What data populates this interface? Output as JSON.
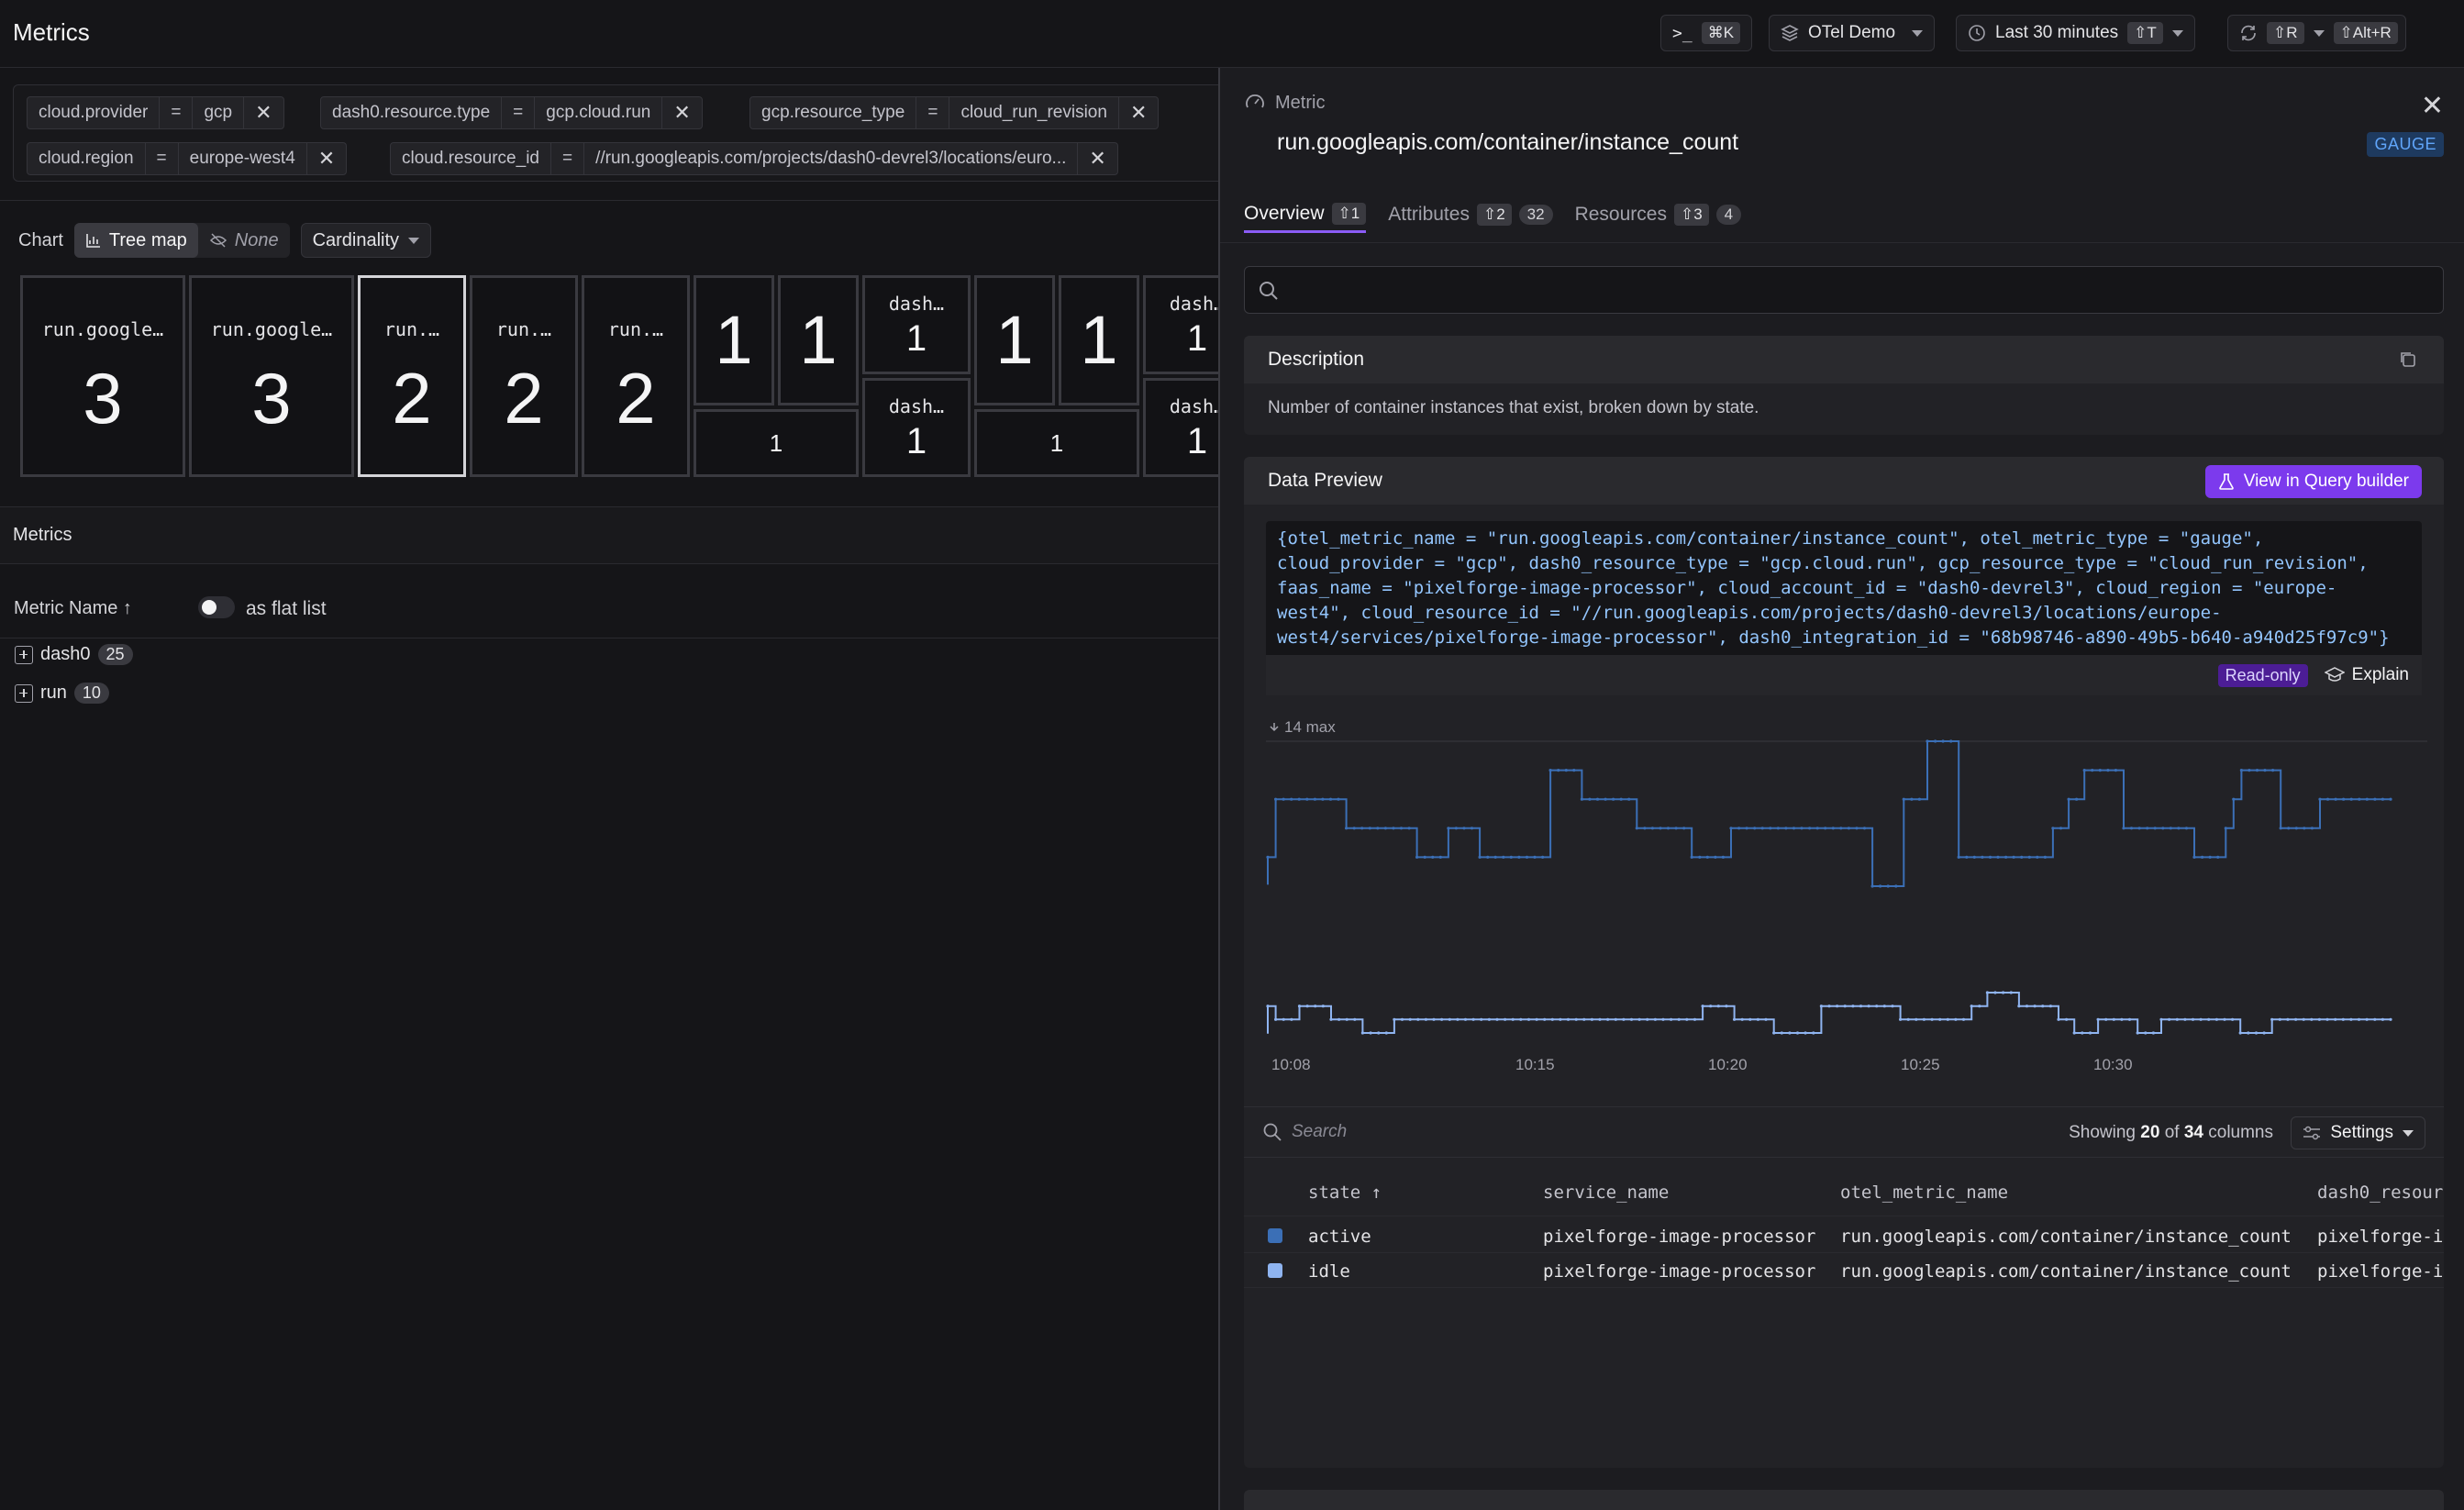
{
  "app": {
    "title": "Metrics"
  },
  "topbar": {
    "command_kbd": "⌘K",
    "dataset": "OTel Demo",
    "time_range": "Last 30 minutes",
    "time_kbd": "⇧T",
    "refresh_kbd": "⇧R",
    "alt_kbd": "⇧Alt+R"
  },
  "filters": [
    {
      "key": "cloud.provider",
      "op": "=",
      "value": "gcp"
    },
    {
      "key": "dash0.resource.type",
      "op": "=",
      "value": "gcp.cloud.run"
    },
    {
      "key": "gcp.resource_type",
      "op": "=",
      "value": "cloud_run_revision"
    },
    {
      "key": "cloud.region",
      "op": "=",
      "value": "europe-west4"
    },
    {
      "key": "cloud.resource_id",
      "op": "=",
      "value": "//run.googleapis.com/projects/dash0-devrel3/locations/euro..."
    }
  ],
  "chart_controls": {
    "label": "Chart",
    "treemap": "Tree map",
    "none": "None",
    "cardinality": "Cardinality"
  },
  "treemap": [
    {
      "label": "run.google…",
      "value": "3"
    },
    {
      "label": "run.google…",
      "value": "3"
    },
    {
      "label": "run.…",
      "value": "2"
    },
    {
      "label": "run.…",
      "value": "2"
    },
    {
      "label": "run.…",
      "value": "2"
    },
    {
      "label": "",
      "value": "1"
    },
    {
      "label": "",
      "value": "1"
    },
    {
      "label": "",
      "value": "1"
    },
    {
      "label": "dash…",
      "value": "1"
    },
    {
      "label": "dash…",
      "value": "1"
    },
    {
      "label": "",
      "value": "1"
    },
    {
      "label": "",
      "value": "1"
    },
    {
      "label": "",
      "value": "1"
    },
    {
      "label": "dash…",
      "value": "1"
    },
    {
      "label": "dash…",
      "value": "1"
    }
  ],
  "metrics_list": {
    "header": "Metrics",
    "sort_column": "Metric Name ↑",
    "flat_list_label": "as flat list",
    "items": [
      {
        "name": "dash0",
        "count": "25"
      },
      {
        "name": "run",
        "count": "10"
      }
    ]
  },
  "detail": {
    "kind": "Metric",
    "title": "run.googleapis.com/container/instance_count",
    "badge": "GAUGE",
    "tabs": [
      {
        "label": "Overview",
        "kbd": "⇧1",
        "count": ""
      },
      {
        "label": "Attributes",
        "kbd": "⇧2",
        "count": "32"
      },
      {
        "label": "Resources",
        "kbd": "⇧3",
        "count": "4"
      }
    ],
    "description_title": "Description",
    "description": "Number of container instances that exist, broken down by state.",
    "data_preview_title": "Data Preview",
    "query_builder_label": "View in Query builder",
    "query_lines": [
      "{otel_metric_name = \"run.googleapis.com/container/instance_count\", otel_metric_type = \"gauge\",",
      "cloud_provider = \"gcp\", dash0_resource_type = \"gcp.cloud.run\", gcp_resource_type = \"cloud_run_revision\",",
      "faas_name = \"pixelforge-image-processor\", cloud_account_id = \"dash0-devrel3\", cloud_region = \"europe-",
      "west4\", cloud_resource_id = \"//run.googleapis.com/projects/dash0-devrel3/locations/europe-",
      "west4/services/pixelforge-image-processor\", dash0_integration_id = \"68b98746-a890-49b5-b640-a940d25f97c9\"}"
    ],
    "readonly_label": "Read-only",
    "explain_label": "Explain",
    "table_search_placeholder": "Search",
    "showing_prefix": "Showing",
    "showing_count": "20",
    "showing_of": "of",
    "showing_total": "34",
    "showing_suffix": "columns",
    "settings_label": "Settings",
    "columns": [
      "state ↑",
      "service_name",
      "otel_metric_name",
      "dash0_resour"
    ],
    "rows": [
      {
        "color": "#3b6fb6",
        "state": "active",
        "service_name": "pixelforge-image-processor",
        "otel_metric_name": "run.googleapis.com/container/instance_count",
        "dash0": "pixelforge-i"
      },
      {
        "color": "#8fb4f0",
        "state": "idle",
        "service_name": "pixelforge-image-processor",
        "otel_metric_name": "run.googleapis.com/container/instance_count",
        "dash0": "pixelforge-i"
      }
    ]
  },
  "chart_data": {
    "type": "line",
    "max_label": "14 max",
    "x_ticks": [
      "10:08",
      "10:15",
      "10:20",
      "10:25",
      "10:30"
    ],
    "series": [
      {
        "color": "#3b6fb6",
        "values": [
          10,
          12,
          12,
          12,
          12,
          12,
          12,
          12,
          12,
          12,
          11,
          11,
          11,
          11,
          11,
          11,
          11,
          11,
          11,
          10,
          10,
          10,
          10,
          11,
          11,
          11,
          11,
          10,
          10,
          10,
          10,
          10,
          10,
          10,
          10,
          10,
          13,
          13,
          13,
          13,
          12,
          12,
          12,
          12,
          12,
          12,
          12,
          11,
          11,
          11,
          11,
          11,
          11,
          11,
          10,
          10,
          10,
          10,
          10,
          11,
          11,
          11,
          11,
          11,
          11,
          11,
          11,
          11,
          11,
          11,
          11,
          11,
          11,
          11,
          11,
          11,
          11,
          9,
          9,
          9,
          9,
          12,
          12,
          12,
          14,
          14,
          14,
          14,
          10,
          10,
          10,
          10,
          10,
          10,
          10,
          10,
          10,
          10,
          10,
          10,
          11,
          11,
          12,
          12,
          13,
          13,
          13,
          13,
          13,
          11,
          11,
          11,
          11,
          11,
          11,
          11,
          11,
          11,
          10,
          10,
          10,
          10,
          11,
          12,
          13,
          13,
          13,
          13,
          13,
          11,
          11,
          11,
          11,
          11,
          12,
          12,
          12,
          12,
          12,
          12,
          12,
          12,
          12,
          12
        ]
      },
      {
        "color": "#8fb4f0",
        "values": [
          3,
          2,
          2,
          2,
          3,
          3,
          3,
          3,
          2,
          2,
          2,
          2,
          1,
          1,
          1,
          1,
          2,
          2,
          2,
          2,
          2,
          2,
          2,
          2,
          2,
          2,
          2,
          2,
          2,
          2,
          2,
          2,
          2,
          2,
          2,
          2,
          2,
          2,
          2,
          2,
          2,
          2,
          2,
          2,
          2,
          2,
          2,
          2,
          2,
          2,
          2,
          2,
          2,
          2,
          2,
          3,
          3,
          3,
          3,
          2,
          2,
          2,
          2,
          2,
          1,
          1,
          1,
          1,
          1,
          1,
          3,
          3,
          3,
          3,
          3,
          3,
          3,
          3,
          3,
          3,
          2,
          2,
          2,
          2,
          2,
          2,
          2,
          2,
          2,
          3,
          3,
          4,
          4,
          4,
          4,
          3,
          3,
          3,
          3,
          3,
          2,
          2,
          1,
          1,
          1,
          2,
          2,
          2,
          2,
          2,
          1,
          1,
          1,
          2,
          2,
          2,
          2,
          2,
          2,
          2,
          2,
          2,
          2,
          1,
          1,
          1,
          1,
          2,
          2,
          2,
          2,
          2,
          2,
          2,
          2,
          2,
          2,
          2,
          2,
          2,
          2,
          2,
          2
        ]
      }
    ]
  }
}
